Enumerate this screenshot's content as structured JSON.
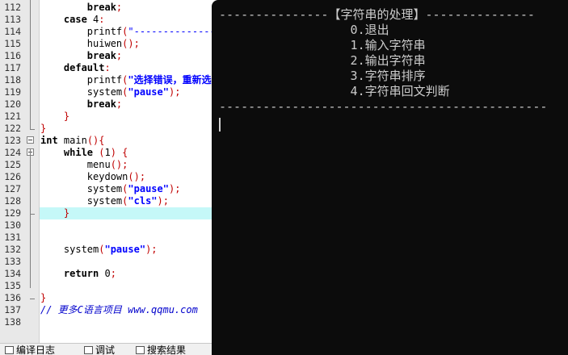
{
  "editor": {
    "lines": [
      {
        "n": "112",
        "segs": [
          {
            "t": "        ",
            "c": ""
          },
          {
            "t": "break",
            "c": "kw"
          },
          {
            "t": ";",
            "c": "punc"
          }
        ]
      },
      {
        "n": "113",
        "segs": [
          {
            "t": "    ",
            "c": ""
          },
          {
            "t": "case",
            "c": "kw"
          },
          {
            "t": " ",
            "c": ""
          },
          {
            "t": "4",
            "c": "num"
          },
          {
            "t": ":",
            "c": "punc"
          }
        ]
      },
      {
        "n": "114",
        "segs": [
          {
            "t": "        printf",
            "c": ""
          },
          {
            "t": "(",
            "c": "punc"
          },
          {
            "t": "\"-------------------",
            "c": "str"
          }
        ]
      },
      {
        "n": "115",
        "segs": [
          {
            "t": "        huiwen",
            "c": ""
          },
          {
            "t": "();",
            "c": "punc"
          }
        ]
      },
      {
        "n": "116",
        "segs": [
          {
            "t": "        ",
            "c": ""
          },
          {
            "t": "break",
            "c": "kw"
          },
          {
            "t": ";",
            "c": "punc"
          }
        ]
      },
      {
        "n": "117",
        "segs": [
          {
            "t": "    ",
            "c": ""
          },
          {
            "t": "default",
            "c": "kw"
          },
          {
            "t": ":",
            "c": "punc"
          }
        ]
      },
      {
        "n": "118",
        "segs": [
          {
            "t": "        printf",
            "c": ""
          },
          {
            "t": "(",
            "c": "punc"
          },
          {
            "t": "\"选择错误，重新选",
            "c": "strb"
          }
        ]
      },
      {
        "n": "119",
        "segs": [
          {
            "t": "        system",
            "c": ""
          },
          {
            "t": "(",
            "c": "punc"
          },
          {
            "t": "\"pause\"",
            "c": "strb"
          },
          {
            "t": ");",
            "c": "punc"
          }
        ]
      },
      {
        "n": "120",
        "segs": [
          {
            "t": "        ",
            "c": ""
          },
          {
            "t": "break",
            "c": "kw"
          },
          {
            "t": ";",
            "c": "punc"
          }
        ]
      },
      {
        "n": "121",
        "segs": [
          {
            "t": "    ",
            "c": ""
          },
          {
            "t": "}",
            "c": "punc"
          }
        ]
      },
      {
        "n": "122",
        "segs": [
          {
            "t": "}",
            "c": "punc"
          }
        ]
      },
      {
        "n": "123",
        "segs": [
          {
            "t": "int",
            "c": "kw"
          },
          {
            "t": " main",
            "c": ""
          },
          {
            "t": "(){",
            "c": "punc"
          }
        ]
      },
      {
        "n": "124",
        "segs": [
          {
            "t": "    ",
            "c": ""
          },
          {
            "t": "while",
            "c": "kw"
          },
          {
            "t": " ",
            "c": ""
          },
          {
            "t": "(",
            "c": "punc"
          },
          {
            "t": "1",
            "c": "num"
          },
          {
            "t": ") {",
            "c": "punc"
          }
        ]
      },
      {
        "n": "125",
        "segs": [
          {
            "t": "        menu",
            "c": ""
          },
          {
            "t": "();",
            "c": "punc"
          }
        ]
      },
      {
        "n": "126",
        "segs": [
          {
            "t": "        keydown",
            "c": ""
          },
          {
            "t": "();",
            "c": "punc"
          }
        ]
      },
      {
        "n": "127",
        "segs": [
          {
            "t": "        system",
            "c": ""
          },
          {
            "t": "(",
            "c": "punc"
          },
          {
            "t": "\"pause\"",
            "c": "strb"
          },
          {
            "t": ");",
            "c": "punc"
          }
        ]
      },
      {
        "n": "128",
        "segs": [
          {
            "t": "        system",
            "c": ""
          },
          {
            "t": "(",
            "c": "punc"
          },
          {
            "t": "\"cls\"",
            "c": "strb"
          },
          {
            "t": ");",
            "c": "punc"
          }
        ]
      },
      {
        "n": "129",
        "segs": [
          {
            "t": "    ",
            "c": ""
          },
          {
            "t": "}",
            "c": "punc"
          }
        ]
      },
      {
        "n": "130",
        "segs": []
      },
      {
        "n": "131",
        "segs": []
      },
      {
        "n": "132",
        "segs": [
          {
            "t": "    system",
            "c": ""
          },
          {
            "t": "(",
            "c": "punc"
          },
          {
            "t": "\"pause\"",
            "c": "strb"
          },
          {
            "t": ");",
            "c": "punc"
          }
        ]
      },
      {
        "n": "133",
        "segs": []
      },
      {
        "n": "134",
        "segs": [
          {
            "t": "    ",
            "c": ""
          },
          {
            "t": "return",
            "c": "kw"
          },
          {
            "t": " ",
            "c": ""
          },
          {
            "t": "0",
            "c": "num"
          },
          {
            "t": ";",
            "c": "punc"
          }
        ]
      },
      {
        "n": "135",
        "segs": []
      },
      {
        "n": "136",
        "segs": [
          {
            "t": "}",
            "c": "punc"
          }
        ]
      },
      {
        "n": "137",
        "segs": [
          {
            "t": "// 更多C语言项目 www.qqmu.com",
            "c": "cmt"
          }
        ]
      },
      {
        "n": "138",
        "segs": []
      }
    ],
    "highlight_line": "129"
  },
  "bottom_tabs": [
    {
      "label": "编译日志",
      "icon": "compile-log-icon"
    },
    {
      "label": "调试",
      "icon": "debug-icon"
    },
    {
      "label": "搜索结果",
      "icon": "search-results-icon"
    }
  ],
  "console": {
    "lines": [
      "---------------【字符串的处理】---------------",
      "                  0.退出",
      "                  1.输入字符串",
      "                  2.输出字符串",
      "                  3.字符串排序",
      "                  4.字符串回文判断",
      "---------------------------------------------"
    ]
  }
}
